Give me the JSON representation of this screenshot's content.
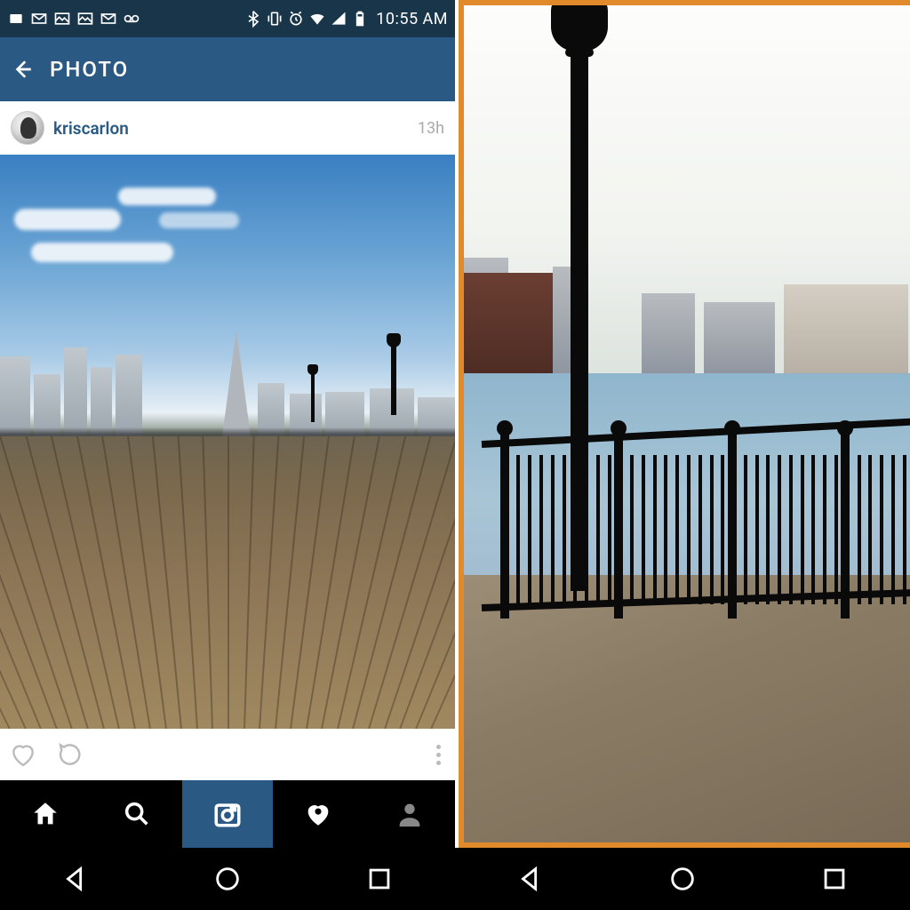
{
  "status_bar": {
    "time": "10:55 AM",
    "icons_left": [
      "notify",
      "mail",
      "image",
      "more-image",
      "mail2",
      "voicemail"
    ],
    "icons_right": [
      "bluetooth",
      "vibrate",
      "alarm",
      "wifi",
      "signal",
      "battery"
    ]
  },
  "app_bar": {
    "title": "PHOTO"
  },
  "post": {
    "username": "kriscarlon",
    "time_ago": "13h"
  },
  "actions": {
    "like": "like",
    "comment": "comment",
    "more": "more"
  },
  "tabs": {
    "items": [
      {
        "name": "home",
        "active": false
      },
      {
        "name": "search",
        "active": false
      },
      {
        "name": "camera",
        "active": true
      },
      {
        "name": "activity",
        "active": false
      },
      {
        "name": "profile",
        "active": false
      }
    ]
  },
  "system_nav": [
    "back",
    "home",
    "recent"
  ],
  "right_panel": {
    "frame_color": "#e08a2c"
  }
}
